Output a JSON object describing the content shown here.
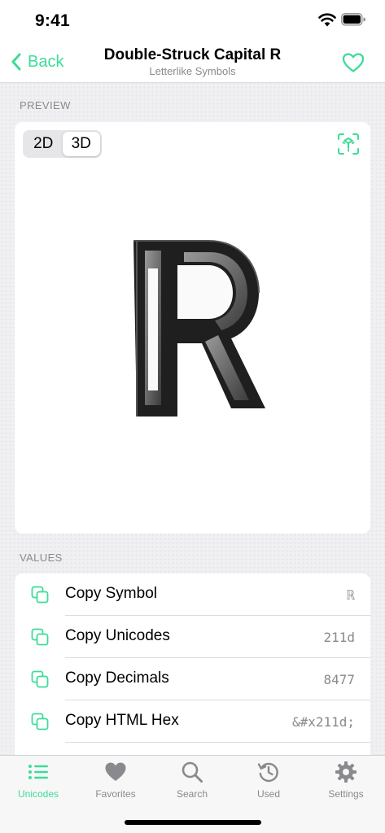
{
  "status_bar": {
    "time": "9:41"
  },
  "nav": {
    "back_label": "Back",
    "title": "Double-Struck Capital R",
    "subtitle": "Letterlike Symbols"
  },
  "preview": {
    "section_label": "PREVIEW",
    "modes": [
      "2D",
      "3D"
    ],
    "selected_mode": "3D",
    "symbol": "ℝ"
  },
  "values": {
    "section_label": "VALUES",
    "rows": [
      {
        "label": "Copy Symbol",
        "value": "ℝ"
      },
      {
        "label": "Copy Unicodes",
        "value": "211d"
      },
      {
        "label": "Copy Decimals",
        "value": "8477"
      },
      {
        "label": "Copy HTML Hex",
        "value": "&#x211d;"
      }
    ]
  },
  "tabs": [
    {
      "label": "Unicodes",
      "icon": "list-icon",
      "active": true
    },
    {
      "label": "Favorites",
      "icon": "heart-icon",
      "active": false
    },
    {
      "label": "Search",
      "icon": "magnifier-icon",
      "active": false
    },
    {
      "label": "Used",
      "icon": "history-icon",
      "active": false
    },
    {
      "label": "Settings",
      "icon": "gear-icon",
      "active": false
    }
  ],
  "colors": {
    "accent": "#3ddc97",
    "secondary_text": "#8a8a8e",
    "background": "#f0f0f3"
  }
}
